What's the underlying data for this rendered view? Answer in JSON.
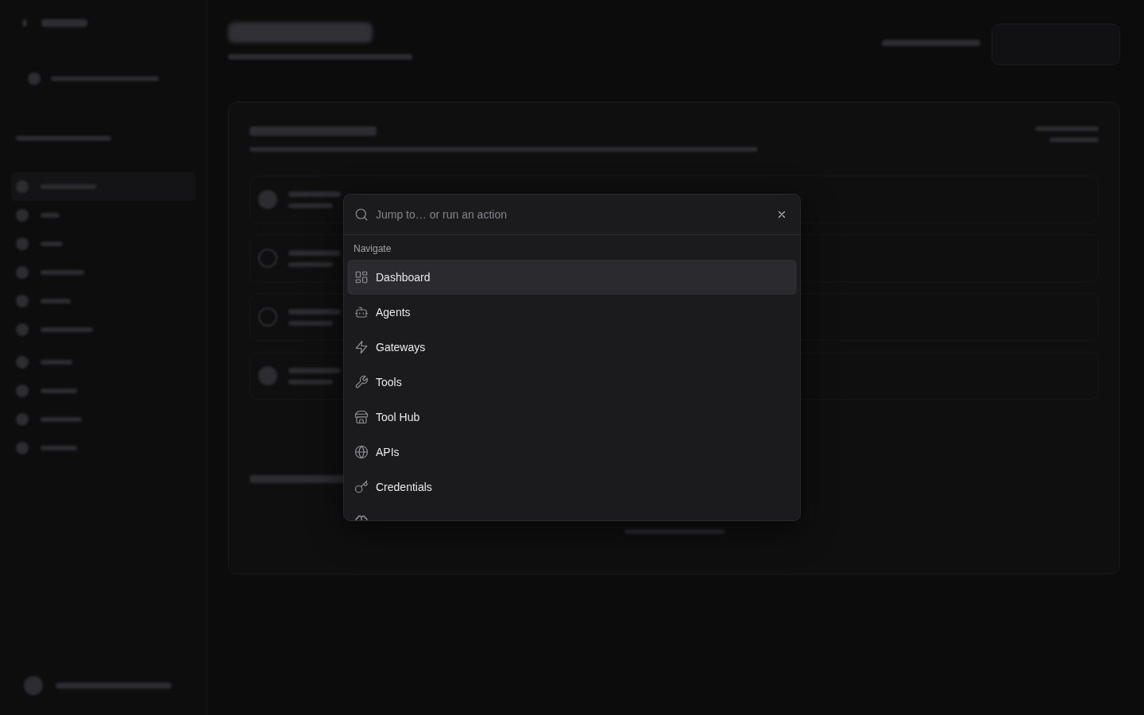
{
  "search": {
    "placeholder": "Jump to… or run an action"
  },
  "groups": [
    {
      "title": "Navigate",
      "items": [
        {
          "label": "Dashboard",
          "selected": true
        },
        {
          "label": "Agents",
          "selected": false
        },
        {
          "label": "Gateways",
          "selected": false
        },
        {
          "label": "Tools",
          "selected": false
        },
        {
          "label": "Tool Hub",
          "selected": false
        },
        {
          "label": "APIs",
          "selected": false
        },
        {
          "label": "Credentials",
          "selected": false
        }
      ]
    }
  ]
}
